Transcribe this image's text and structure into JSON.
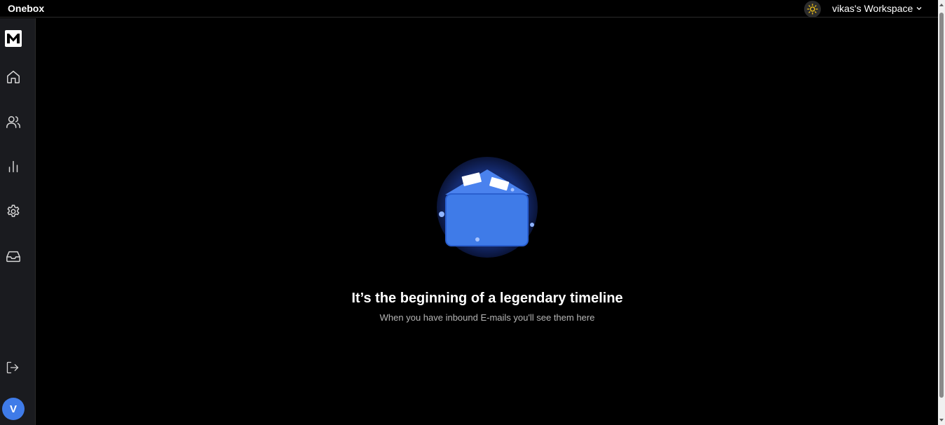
{
  "header": {
    "app_title": "Onebox",
    "workspace_label": "vikas's Workspace",
    "theme_icon": "sun-icon"
  },
  "sidebar": {
    "logo_icon": "m-logo-icon",
    "items": [
      {
        "name": "home",
        "icon": "home-icon"
      },
      {
        "name": "contacts",
        "icon": "users-icon"
      },
      {
        "name": "analytics",
        "icon": "bar-chart-icon"
      },
      {
        "name": "settings",
        "icon": "gear-icon"
      },
      {
        "name": "inbox",
        "icon": "inbox-icon"
      }
    ],
    "logout_icon": "logout-icon",
    "avatar_initial": "V"
  },
  "main": {
    "empty_state": {
      "title": "It’s the beginning of a legendary timeline",
      "subtitle": "When you have inbound E-mails you'll see them here"
    }
  },
  "colors": {
    "background": "#000000",
    "sidebar": "#1a1b1f",
    "accent": "#3f7be8",
    "sun": "#f5c518"
  }
}
